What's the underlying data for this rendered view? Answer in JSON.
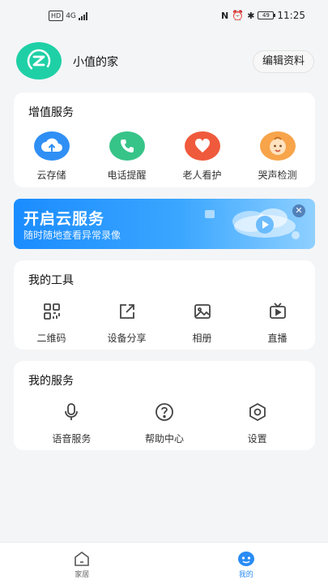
{
  "status_bar": {
    "left_badge": "HD",
    "network": "4G",
    "battery": "49",
    "time": "11:25"
  },
  "profile": {
    "name": "小值的家",
    "edit_label": "编辑资料"
  },
  "value_services": {
    "title": "增值服务",
    "items": [
      {
        "label": "云存储",
        "icon": "cloud-upload-icon",
        "color": "#2f8ff5"
      },
      {
        "label": "电话提醒",
        "icon": "phone-icon",
        "color": "#37c489"
      },
      {
        "label": "老人看护",
        "icon": "heart-icon",
        "color": "#ef5a3c"
      },
      {
        "label": "哭声检测",
        "icon": "baby-face-icon",
        "color": "#f7a44a"
      }
    ]
  },
  "banner": {
    "title": "开启云服务",
    "subtitle": "随时随地查看异常录像",
    "close": "✕"
  },
  "my_tools": {
    "title": "我的工具",
    "items": [
      {
        "label": "二维码",
        "icon": "qr-code-icon"
      },
      {
        "label": "设备分享",
        "icon": "share-icon"
      },
      {
        "label": "相册",
        "icon": "album-icon"
      },
      {
        "label": "直播",
        "icon": "live-tv-icon"
      }
    ]
  },
  "my_services": {
    "title": "我的服务",
    "items": [
      {
        "label": "语音服务",
        "icon": "microphone-icon"
      },
      {
        "label": "帮助中心",
        "icon": "help-icon"
      },
      {
        "label": "设置",
        "icon": "settings-icon"
      }
    ]
  },
  "tabbar": {
    "tabs": [
      {
        "label": "家居",
        "icon": "home-icon",
        "active": false
      },
      {
        "label": "我的",
        "icon": "mine-icon",
        "active": true
      }
    ],
    "active_color": "#2a8cf4",
    "inactive_color": "#666666"
  }
}
